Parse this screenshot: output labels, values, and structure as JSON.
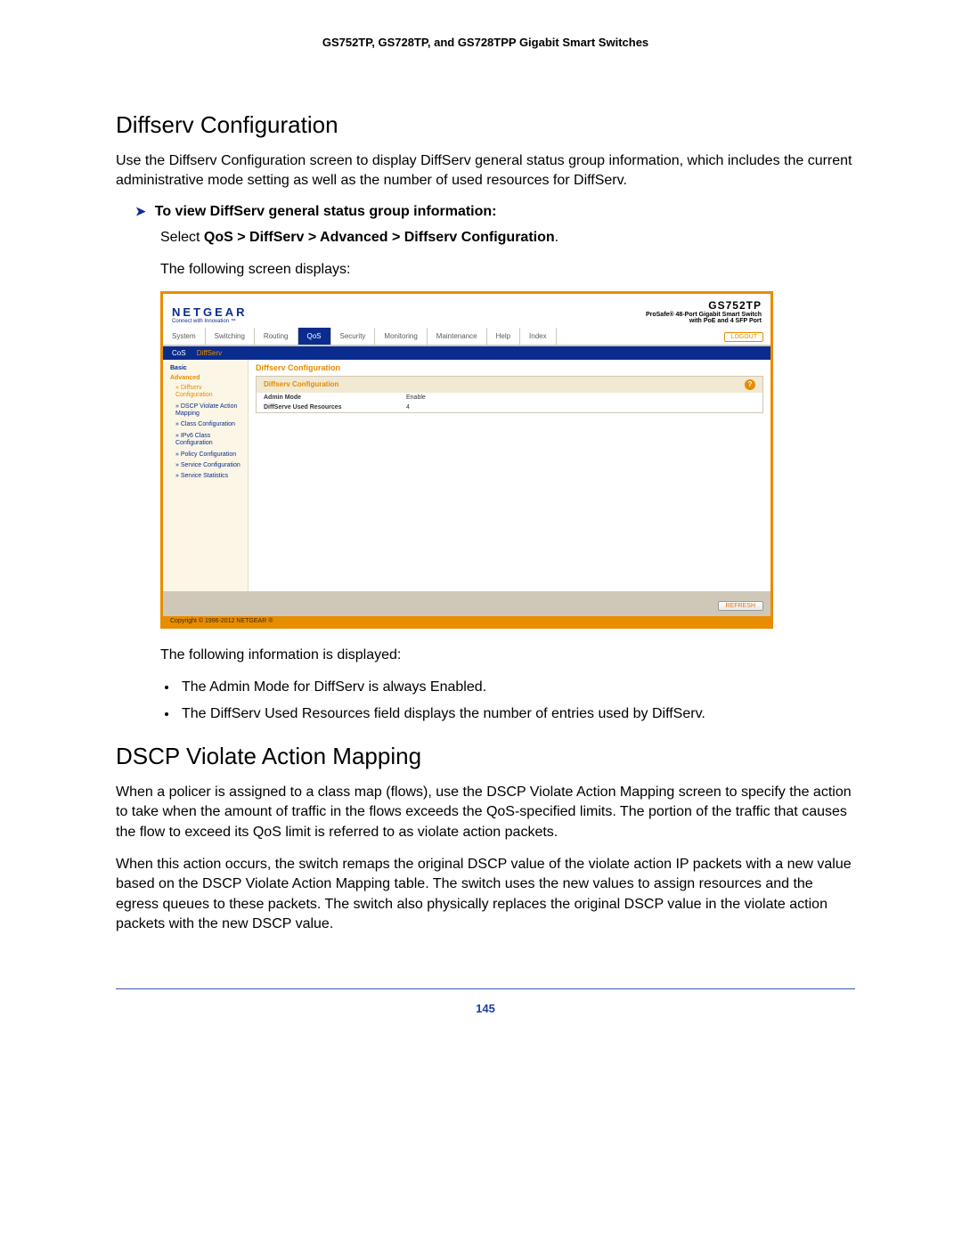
{
  "doc_header": "GS752TP, GS728TP, and GS728TPP Gigabit Smart Switches",
  "h1a": "Diffserv Configuration",
  "p1": "Use the Diffserv Configuration screen to display DiffServ general status group information, which includes the current administrative mode setting as well as the number of used resources for DiffServ.",
  "proc_title": "To view DiffServ general status group information:",
  "select_prefix": "Select ",
  "select_path": "QoS > DiffServ > Advanced > Diffserv Configuration",
  "select_suffix": ".",
  "p_following": "The following screen displays:",
  "p_following2": "The following information is displayed:",
  "bullets": [
    "The Admin Mode for DiffServ is always Enabled.",
    "The DiffServ Used Resources field displays the number of entries used by DiffServ."
  ],
  "h1b": "DSCP Violate Action Mapping",
  "p2": "When a policer is assigned to a class map (flows), use the DSCP Violate Action Mapping screen to specify the action to take when the amount of traffic in the flows exceeds the QoS-specified limits. The portion of the traffic that causes the flow to exceed its QoS limit is referred to as violate action packets.",
  "p3": "When this action occurs, the switch remaps the original DSCP value of the violate action IP packets with a new value based on the DSCP Violate Action Mapping table. The switch uses the new values to assign resources and the egress queues to these packets. The switch also physically replaces the original DSCP value in the violate action packets with the new DSCP value.",
  "page_number": "145",
  "shot": {
    "brand": "NETGEAR",
    "tagline": "Connect with Innovation ™",
    "model": "GS752TP",
    "model_desc1": "ProSafe® 48-Port Gigabit Smart Switch",
    "model_desc2": "with PoE and 4 SFP Port",
    "tabs": [
      "System",
      "Switching",
      "Routing",
      "QoS",
      "Security",
      "Monitoring",
      "Maintenance",
      "Help",
      "Index"
    ],
    "active_tab_index": 3,
    "logout": "LOGOUT",
    "subtabs": {
      "a": "CoS",
      "b": "DiffServ"
    },
    "side_groups": {
      "basic": "Basic",
      "advanced": "Advanced"
    },
    "side_items": [
      "Diffserv Configuration",
      "DSCP Violate Action Mapping",
      "Class Configuration",
      "IPv6 Class Configuration",
      "Policy Configuration",
      "Service Configuration",
      "Service Statistics"
    ],
    "main_title": "Diffserv Configuration",
    "panel_title": "Diffserv Configuration",
    "rows": [
      {
        "k": "Admin Mode",
        "v": "Enable"
      },
      {
        "k": "DiffServe Used Resources",
        "v": "4"
      }
    ],
    "refresh": "REFRESH",
    "copyright": "Copyright © 1996-2012 NETGEAR ®"
  }
}
